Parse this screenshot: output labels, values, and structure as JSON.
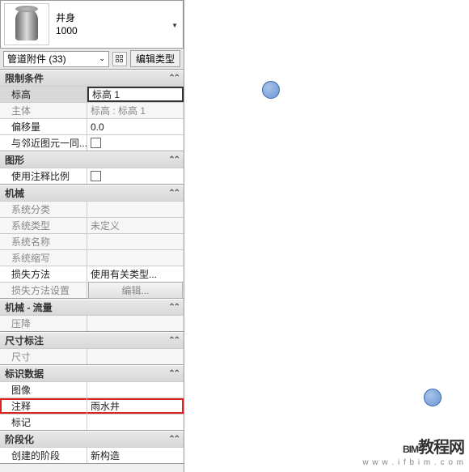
{
  "header": {
    "name": "井身",
    "size": "1000"
  },
  "toolbar": {
    "category": "管道附件 (33)",
    "edit_type": "编辑类型"
  },
  "sections": {
    "constraints": {
      "title": "限制条件",
      "level_label": "标高",
      "level_value": "标高 1",
      "host_label": "主体",
      "host_value": "标高 : 标高 1",
      "offset_label": "偏移量",
      "offset_value": "0.0",
      "move_with_label": "与邻近图元一同..."
    },
    "graphics": {
      "title": "图形",
      "anno_scale_label": "使用注释比例"
    },
    "mechanical": {
      "title": "机械",
      "sys_class_label": "系统分类",
      "sys_type_label": "系统类型",
      "sys_type_value": "未定义",
      "sys_name_label": "系统名称",
      "sys_abbrev_label": "系统缩写",
      "loss_method_label": "损失方法",
      "loss_method_value": "使用有关类型...",
      "loss_settings_label": "损失方法设置",
      "loss_settings_btn": "编辑..."
    },
    "mech_flow": {
      "title": "机械 - 流量",
      "pressure_drop_label": "压降"
    },
    "dimensions": {
      "title": "尺寸标注",
      "size_label": "尺寸"
    },
    "identity": {
      "title": "标识数据",
      "image_label": "图像",
      "comment_label": "注释",
      "comment_value": "雨水井",
      "mark_label": "标记"
    },
    "phasing": {
      "title": "阶段化",
      "phase_created_label": "创建的阶段",
      "phase_created_value": "新构造"
    }
  },
  "logo": {
    "main_en": "BIM",
    "main_zh": "教程网",
    "sub": "w w w . i f b i m . c o m"
  }
}
